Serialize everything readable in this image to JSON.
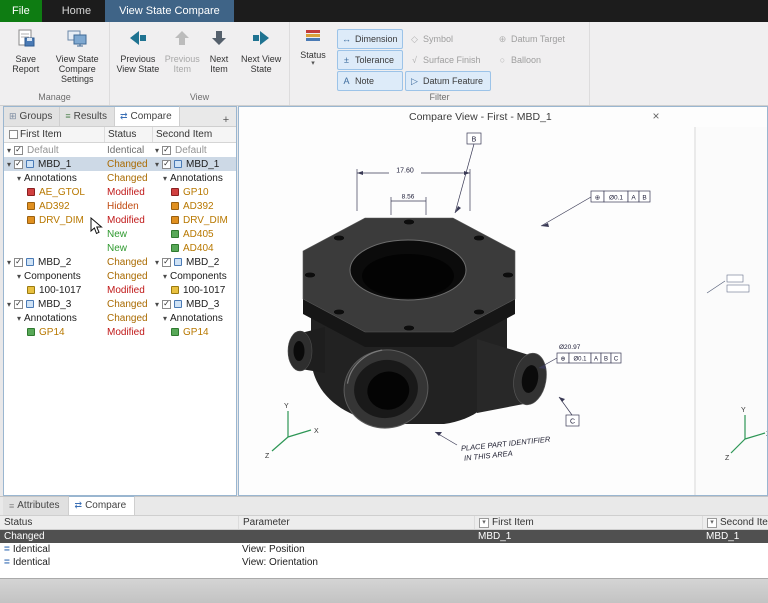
{
  "titlebar": {
    "file_tab": "File",
    "home_tab": "Home",
    "active_tab": "View State Compare"
  },
  "ribbon": {
    "manage": {
      "label": "Manage",
      "save_report": "Save Report",
      "settings": "View State Compare Settings"
    },
    "view": {
      "label": "View",
      "prev_state": "Previous View State",
      "prev_item": "Previous Item",
      "next_item": "Next Item",
      "next_state": "Next View State"
    },
    "filter": {
      "label": "Filter",
      "status_button": "Status",
      "toggles": [
        {
          "label": "Dimension",
          "icon": "↔",
          "state": "on"
        },
        {
          "label": "Symbol",
          "icon": "◇",
          "state": "off"
        },
        {
          "label": "Datum Target",
          "icon": "⊕",
          "state": "off"
        },
        {
          "label": "Tolerance",
          "icon": "±",
          "state": "on"
        },
        {
          "label": "Surface Finish",
          "icon": "√",
          "state": "off"
        },
        {
          "label": "Balloon",
          "icon": "○",
          "state": "off"
        },
        {
          "label": "Note",
          "icon": "A",
          "state": "on"
        },
        {
          "label": "Datum Feature",
          "icon": "▷",
          "state": "on"
        }
      ]
    }
  },
  "left_panel": {
    "tabs": [
      {
        "label": "Groups"
      },
      {
        "label": "Results"
      },
      {
        "label": "Compare",
        "active": true
      }
    ],
    "add_tab": "+",
    "columns": {
      "first": "First Item",
      "status": "Status",
      "second": "Second Item"
    },
    "colors": {
      "status": {
        "Identical": "#6f6f6f",
        "Changed": "#a96a00",
        "Modified": "#c01818",
        "Hidden": "#c04a10",
        "New": "#2f9a2f"
      },
      "name": {
        "norm": "#1c1c1c",
        "dim": "#949494",
        "ann": "#b87800"
      }
    },
    "rows": [
      {
        "lv": 0,
        "exp": 1,
        "cb": 1,
        "f": "Default",
        "s": "Identical",
        "sec": "Default",
        "fcol": "dim"
      },
      {
        "lv": 0,
        "exp": 1,
        "cb": 1,
        "ic": "view",
        "f": "MBD_1",
        "s": "Changed",
        "sec": "MBD_1",
        "sel": 1
      },
      {
        "lv": 1,
        "exp": 1,
        "f": "Annotations",
        "s": "Changed",
        "sec": "Annotations"
      },
      {
        "lv": 2,
        "ic": "flag-red",
        "f": "AE_GTOL",
        "s": "Modified",
        "sec": "GP10",
        "fcol": "ann"
      },
      {
        "lv": 2,
        "ic": "flag-orange",
        "f": "AD392",
        "s": "Hidden",
        "sec": "AD392",
        "fcol": "ann"
      },
      {
        "lv": 2,
        "ic": "flag-orange",
        "f": "DRV_DIM",
        "s": "Modified",
        "sec": "DRV_DIM",
        "fcol": "ann"
      },
      {
        "lv": 2,
        "f": "",
        "s": "New",
        "sec": "AD405",
        "fcol": "ann",
        "ic2": "flag-green"
      },
      {
        "lv": 2,
        "f": "",
        "s": "New",
        "sec": "AD404",
        "fcol": "ann",
        "ic2": "flag-green"
      },
      {
        "lv": 0,
        "exp": 1,
        "cb": 1,
        "ic": "view",
        "f": "MBD_2",
        "s": "Changed",
        "sec": "MBD_2"
      },
      {
        "lv": 1,
        "exp": 1,
        "f": "Components",
        "s": "Changed",
        "sec": "Components"
      },
      {
        "lv": 2,
        "ic": "part",
        "f": "100-1017",
        "s": "Modified",
        "sec": "100-1017",
        "fcol": "norm"
      },
      {
        "lv": 0,
        "exp": 1,
        "cb": 1,
        "ic": "view",
        "f": "MBD_3",
        "s": "Changed",
        "sec": "MBD_3"
      },
      {
        "lv": 1,
        "exp": 1,
        "f": "Annotations",
        "s": "Changed",
        "sec": "Annotations"
      },
      {
        "lv": 2,
        "ic": "flag-green",
        "f": "GP14",
        "s": "Modified",
        "sec": "GP14",
        "fcol": "ann"
      }
    ]
  },
  "viewport": {
    "title": "Compare View - First - MBD_1",
    "close": "×",
    "annotations": {
      "dim_top": "17.60",
      "dim_sub": "8.56",
      "datum_b": "B",
      "datum_c": "C",
      "fcf1": {
        "sym": "⊕",
        "tol": "Ø0.1",
        "d1": "A",
        "d2": "B"
      },
      "port_dia": "Ø20.97",
      "fcf2": {
        "sym": "⊕",
        "tol": "Ø0.1",
        "d1": "A",
        "d2": "B",
        "d3": "C"
      },
      "note1": "PLACE PART IDENTIFIER",
      "note2": "IN THIS AREA"
    },
    "triad": {
      "x": "X",
      "y": "Y",
      "z": "Z"
    }
  },
  "bottom_panel": {
    "tabs": [
      {
        "label": "Attributes"
      },
      {
        "label": "Compare",
        "active": true
      }
    ],
    "columns": {
      "status": "Status",
      "parameter": "Parameter",
      "first": "First Item",
      "second": "Second Item"
    },
    "rows": [
      {
        "status": "Changed",
        "param": "",
        "first": "MBD_1",
        "second": "MBD_1",
        "sel": 1
      },
      {
        "status": "Identical",
        "param": "View: Position",
        "first": "",
        "second": "",
        "icon": "identical"
      },
      {
        "status": "Identical",
        "param": "View: Orientation",
        "first": "",
        "second": "",
        "icon": "identical"
      }
    ]
  }
}
